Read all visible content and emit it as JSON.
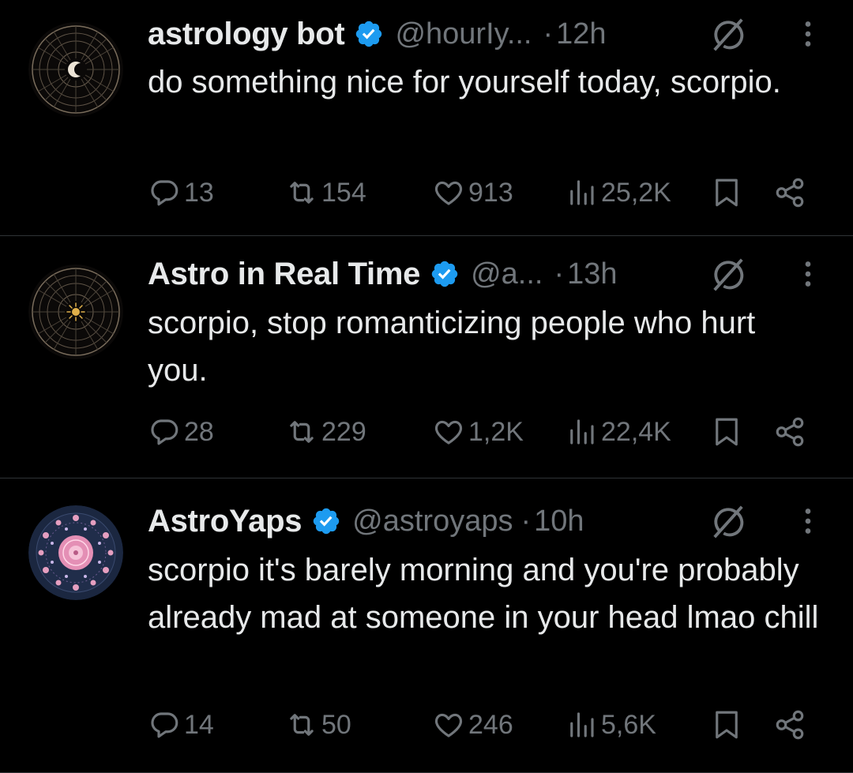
{
  "tweets": [
    {
      "name": "astrology bot",
      "handle": "@hourIy...",
      "dot": "·",
      "time": "12h",
      "text": "do something nice for yourself today, scorpio.",
      "replies": "13",
      "reposts": "154",
      "likes": "913",
      "views": "25,2K"
    },
    {
      "name": "Astro in Real Time",
      "handle": "@a...",
      "dot": "·",
      "time": "13h",
      "text": "scorpio, stop romanticizing people who hurt you.",
      "replies": "28",
      "reposts": "229",
      "likes": "1,2K",
      "views": "22,4K"
    },
    {
      "name": "AstroYaps",
      "handle": "@astroyaps",
      "dot": "·",
      "time": "10h",
      "text": "scorpio it's barely morning and you're probably already mad at someone in your head lmao chill",
      "replies": "14",
      "reposts": "50",
      "likes": "246",
      "views": "5,6K"
    }
  ],
  "icons": {
    "verified": "verified-badge-icon",
    "grok": "grok-icon",
    "more": "more-vertical-icon",
    "reply": "reply-icon",
    "repost": "repost-icon",
    "like": "heart-icon",
    "views": "views-icon",
    "bookmark": "bookmark-icon",
    "share": "share-icon"
  },
  "colors": {
    "background": "#000000",
    "text": "#e7e9ea",
    "secondary": "#71767b",
    "verified": "#1d9bf0",
    "divider": "#2f3336"
  }
}
